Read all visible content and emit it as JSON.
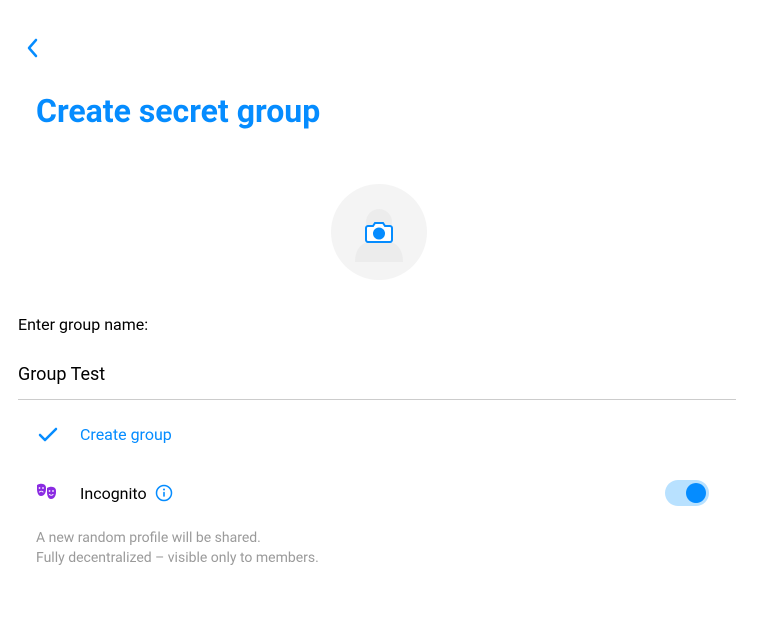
{
  "colors": {
    "accent": "#058cff",
    "purple": "#8a2be2",
    "muted": "#9a9a9a"
  },
  "header": {
    "title": "Create secret group"
  },
  "form": {
    "name_label": "Enter group name:",
    "name_value": "Group Test"
  },
  "actions": {
    "create_label": "Create group"
  },
  "incognito": {
    "label": "Incognito",
    "enabled": true,
    "hint_line1": "A new random profile will be shared.",
    "hint_line2": "Fully decentralized – visible only to members."
  }
}
